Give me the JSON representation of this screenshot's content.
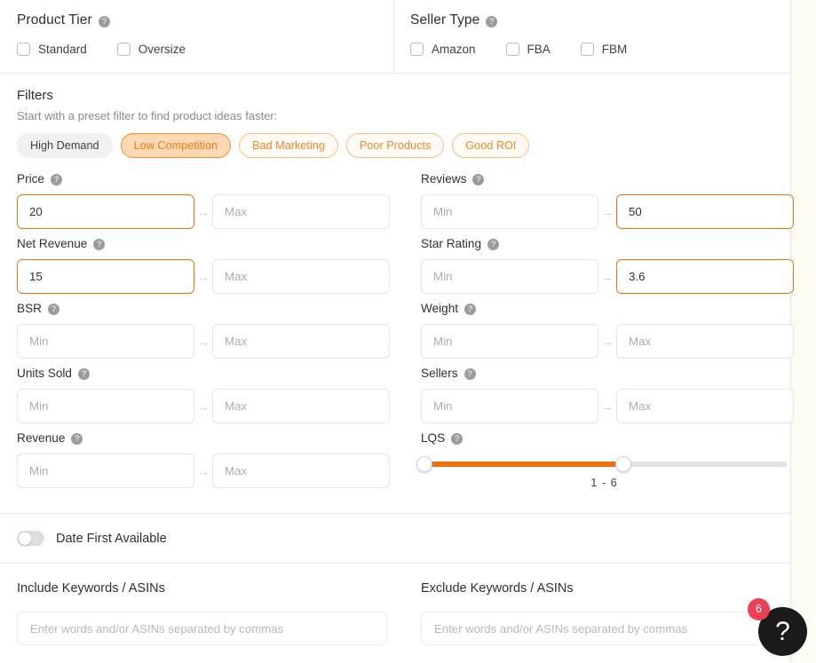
{
  "product_tier": {
    "title": "Product Tier",
    "help_icon": "question-mark-icon",
    "options": [
      {
        "label": "Standard",
        "checked": false
      },
      {
        "label": "Oversize",
        "checked": false
      }
    ]
  },
  "seller_type": {
    "title": "Seller Type",
    "help_icon": "question-mark-icon",
    "options": [
      {
        "label": "Amazon",
        "checked": false
      },
      {
        "label": "FBA",
        "checked": false
      },
      {
        "label": "FBM",
        "checked": false
      }
    ]
  },
  "filters": {
    "title": "Filters",
    "subtitle": "Start with a preset filter to find product ideas faster:",
    "presets": [
      {
        "label": "High Demand",
        "style": "gray"
      },
      {
        "label": "Low Competition",
        "style": "filled"
      },
      {
        "label": "Bad Marketing",
        "style": "outline"
      },
      {
        "label": "Poor Products",
        "style": "outline"
      },
      {
        "label": "Good ROI",
        "style": "outline"
      }
    ],
    "fields": [
      {
        "label": "Price",
        "min": {
          "value": "20",
          "placeholder": "Min",
          "active": true
        },
        "max": {
          "value": "",
          "placeholder": "Max",
          "active": false
        }
      },
      {
        "label": "Reviews",
        "min": {
          "value": "",
          "placeholder": "Min",
          "active": false
        },
        "max": {
          "value": "50",
          "placeholder": "Max",
          "active": true
        }
      },
      {
        "label": "Net Revenue",
        "min": {
          "value": "15",
          "placeholder": "Min",
          "active": true
        },
        "max": {
          "value": "",
          "placeholder": "Max",
          "active": false
        }
      },
      {
        "label": "Star Rating",
        "min": {
          "value": "",
          "placeholder": "Min",
          "active": false
        },
        "max": {
          "value": "3.6",
          "placeholder": "Max",
          "active": true
        }
      },
      {
        "label": "BSR",
        "min": {
          "value": "",
          "placeholder": "Min",
          "active": false
        },
        "max": {
          "value": "",
          "placeholder": "Max",
          "active": false
        }
      },
      {
        "label": "Weight",
        "min": {
          "value": "",
          "placeholder": "Min",
          "active": false
        },
        "max": {
          "value": "",
          "placeholder": "Max",
          "active": false
        }
      },
      {
        "label": "Units Sold",
        "min": {
          "value": "",
          "placeholder": "Min",
          "active": false
        },
        "max": {
          "value": "",
          "placeholder": "Max",
          "active": false
        }
      },
      {
        "label": "Sellers",
        "min": {
          "value": "",
          "placeholder": "Min",
          "active": false
        },
        "max": {
          "value": "",
          "placeholder": "Max",
          "active": false
        }
      },
      {
        "label": "Revenue",
        "min": {
          "value": "",
          "placeholder": "Min",
          "active": false
        },
        "max": {
          "value": "",
          "placeholder": "Max",
          "active": false
        }
      }
    ],
    "lqs": {
      "label": "LQS",
      "min_value": 1,
      "max_value": 6,
      "display": "1 - 6",
      "range_start": 1,
      "range_end": 10
    },
    "arrow_icon": "→"
  },
  "date_first_available": {
    "label": "Date First Available",
    "enabled": false
  },
  "keywords": {
    "include": {
      "title": "Include Keywords / ASINs",
      "value": "",
      "placeholder": "Enter words and/or ASINs separated by commas"
    },
    "exclude": {
      "title": "Exclude Keywords / ASINs",
      "value": "",
      "placeholder": "Enter words and/or ASINs separated by commas"
    }
  },
  "help_widget": {
    "icon": "question-mark-icon",
    "glyph": "?",
    "badge_count": "6"
  },
  "colors": {
    "accent": "#ec7211",
    "chip_filled_bg": "#fbd9b4",
    "chip_outline_border": "#f6bd84",
    "badge_red": "#ec4055",
    "page_bg": "#fdfaf4"
  }
}
